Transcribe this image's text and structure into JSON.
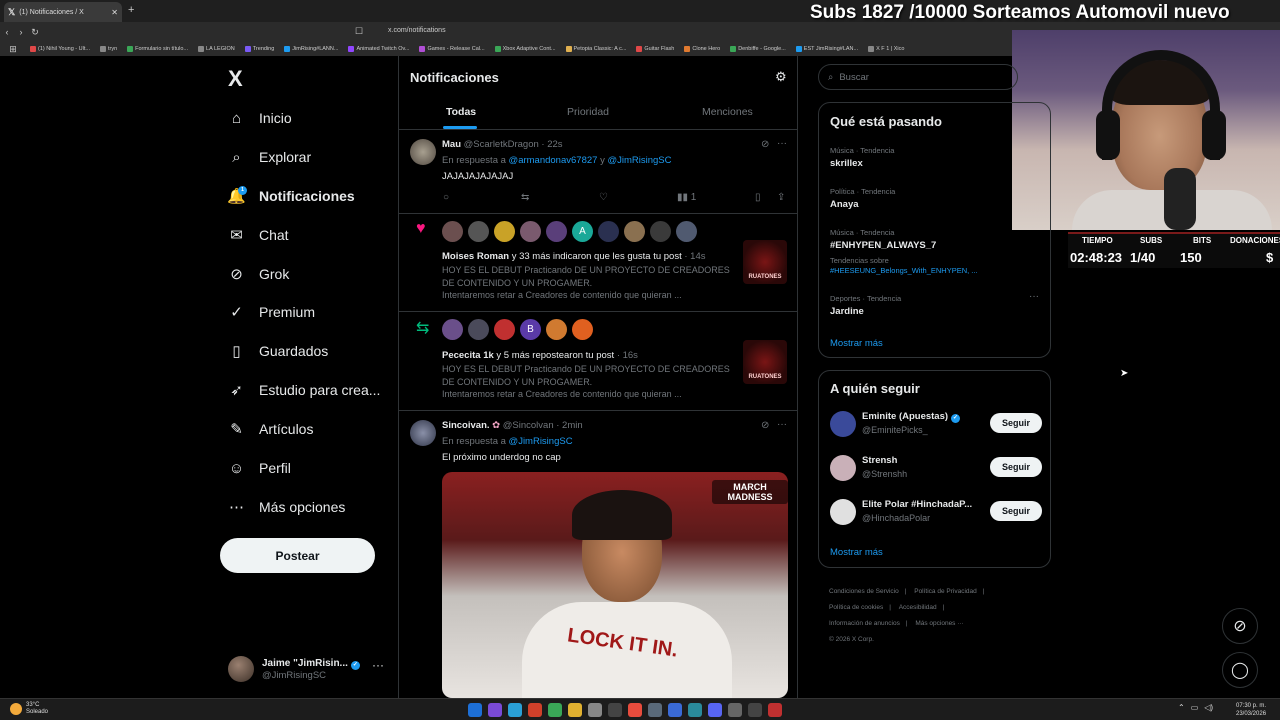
{
  "browser": {
    "tab_title": "(1) Notificaciones / X",
    "new_tab": "+",
    "url": "x.com/notifications",
    "bookmarks": [
      {
        "label": "(1) Nihil Young - Ult...",
        "color": "#e04848"
      },
      {
        "label": "tryn",
        "color": "#888888"
      },
      {
        "label": "Formulario sin título...",
        "color": "#3aa757"
      },
      {
        "label": "LA LEGION",
        "color": "#888888"
      },
      {
        "label": "Trending",
        "color": "#7a5af5"
      },
      {
        "label": "JimRising#LANN...",
        "color": "#1d9bf0"
      },
      {
        "label": "Animated Twitch Ov...",
        "color": "#9146ff"
      },
      {
        "label": "Games - Release Cal...",
        "color": "#b14fd6"
      },
      {
        "label": "Xbox Adaptive Cont...",
        "color": "#3aa757"
      },
      {
        "label": "Petopia Classic: A c...",
        "color": "#e0b050"
      },
      {
        "label": "Guitar Flash",
        "color": "#e04848"
      },
      {
        "label": "Clone Hero",
        "color": "#e07a30"
      },
      {
        "label": "Denbiffe - Google...",
        "color": "#3aa757"
      },
      {
        "label": "EST JimRising#LAN...",
        "color": "#1d9bf0"
      },
      {
        "label": "X F 1 | Xico",
        "color": "#888888"
      }
    ]
  },
  "overlay": {
    "banner": "Subs 1827 /10000 Sorteamos Automovil nuevo",
    "stats": {
      "headers": [
        "TIEMPO",
        "SUBS",
        "BITS",
        "DONACIONES"
      ],
      "values": [
        "02:48:23",
        "1/40",
        "150",
        "$"
      ]
    }
  },
  "sidebar": {
    "logo": "X",
    "items": [
      {
        "label": "Inicio",
        "icon": "home-icon",
        "glyph": "⌂"
      },
      {
        "label": "Explorar",
        "icon": "search-icon",
        "glyph": "⌕"
      },
      {
        "label": "Notificaciones",
        "icon": "bell-icon",
        "glyph": "🔔",
        "badge": "1"
      },
      {
        "label": "Chat",
        "icon": "mail-icon",
        "glyph": "✉"
      },
      {
        "label": "Grok",
        "icon": "grok-icon",
        "glyph": "⊘"
      },
      {
        "label": "Premium",
        "icon": "premium-icon",
        "glyph": "✓"
      },
      {
        "label": "Guardados",
        "icon": "bookmark-icon",
        "glyph": "▯"
      },
      {
        "label": "Estudio para crea...",
        "icon": "rocket-icon",
        "glyph": "➶"
      },
      {
        "label": "Artículos",
        "icon": "article-icon",
        "glyph": "✎"
      },
      {
        "label": "Perfil",
        "icon": "person-icon",
        "glyph": "☺"
      },
      {
        "label": "Más opciones",
        "icon": "more-icon",
        "glyph": "⋯"
      }
    ],
    "post_button": "Postear",
    "account": {
      "name": "Jaime \"JimRisin...",
      "handle": "@JimRisingSC",
      "more": "···"
    }
  },
  "main": {
    "title": "Notificaciones",
    "tabs": [
      "Todas",
      "Prioridad",
      "Menciones"
    ],
    "tweet1": {
      "name": "Mau",
      "handle": "@ScarletkDragon",
      "time": "· 22s",
      "reply_prefix": "En respuesta a",
      "reply_to1": "@armandonav67827",
      "reply_and": "y",
      "reply_to2": "@JimRisingSC",
      "text": "JAJAJAJAJAJAJ",
      "views": "1"
    },
    "like_notif": {
      "who": "Moises Roman",
      "action": "y 33 más indicaron que les gusta tu post",
      "time": "· 14s",
      "lines": [
        "HOY ES EL DEBUT Practicando DE UN PROYECTO DE CREADORES",
        "DE CONTENIDO Y UN PROGAMER.",
        "Intentaremos retar a Creadores de contenido que quieran ..."
      ],
      "logo_text": "RUATONES",
      "avatars": [
        {
          "color": "#6b4f4f",
          "letter": ""
        },
        {
          "color": "#555555",
          "letter": ""
        },
        {
          "color": "#c9a227",
          "letter": ""
        },
        {
          "color": "#7a5a6e",
          "letter": ""
        },
        {
          "color": "#5a3f7a",
          "letter": ""
        },
        {
          "color": "#1aa898",
          "letter": "A"
        },
        {
          "color": "#2a3050",
          "letter": ""
        },
        {
          "color": "#8a7050",
          "letter": ""
        },
        {
          "color": "#3a3a3a",
          "letter": ""
        },
        {
          "color": "#505a70",
          "letter": ""
        }
      ]
    },
    "rt_notif": {
      "who": "Pececita 1k",
      "action": "y 5 más repostearon tu post",
      "time": "· 16s",
      "lines": [
        "HOY ES EL DEBUT Practicando DE UN PROYECTO DE CREADORES",
        "DE CONTENIDO Y UN PROGAMER.",
        "Intentaremos retar a Creadores de contenido que quieran ..."
      ],
      "logo_text": "RUATONES",
      "avatars": [
        {
          "color": "#6a4f8a",
          "letter": ""
        },
        {
          "color": "#4a4a5a",
          "letter": ""
        },
        {
          "color": "#c03030",
          "letter": ""
        },
        {
          "color": "#5a3aa8",
          "letter": "B"
        },
        {
          "color": "#d07a30",
          "letter": ""
        },
        {
          "color": "#e06020",
          "letter": ""
        }
      ]
    },
    "tweet2": {
      "name": "Sincoivan.",
      "handle": "@Sincolvan",
      "time": "· 2min",
      "reply_prefix": "En respuesta a",
      "reply_to": "@JimRisingSC",
      "text": "El próximo underdog no cap",
      "media_brand": "MARCH MADNESS",
      "media_shirt_text": "LOCK IT IN."
    }
  },
  "right": {
    "search_placeholder": "Buscar",
    "trends_title": "Qué está pasando",
    "trends": [
      {
        "meta": "Música · Tendencia",
        "name": "skrillex"
      },
      {
        "meta": "Política · Tendencia",
        "name": "Anaya"
      },
      {
        "meta": "Música · Tendencia",
        "name": "#ENHYPEN_ALWAYS_7",
        "sub": "Tendencias sobre",
        "link": "#HEESEUNG_Belongs_With_ENHYPEN, ..."
      },
      {
        "meta": "Deportes · Tendencia",
        "name": "Jardine"
      }
    ],
    "trends_more": "Mostrar más",
    "follow_title": "A quién seguir",
    "follow": [
      {
        "name": "Eminite (Apuestas)",
        "handle": "@EminitePicks_",
        "verified": true,
        "color": "#3a4a9a"
      },
      {
        "name": "Strensh",
        "handle": "@Strenshh",
        "verified": false,
        "color": "#c9b0b8"
      },
      {
        "name": "Elite Polar #HinchadaP...",
        "handle": "@HinchadaPolar",
        "verified": false,
        "color": "#e0e0e0"
      }
    ],
    "follow_button": "Seguir",
    "follow_more": "Mostrar más",
    "footer": [
      "Condiciones de Servicio",
      "Política de Privacidad",
      "Política de cookies",
      "Accesibilidad",
      "Información de anuncios",
      "Más opciones ···",
      "© 2026 X Corp."
    ]
  },
  "taskbar": {
    "temp": "33°C",
    "condition": "Soleado",
    "time": "07:30 p. m.",
    "date": "23/03/2026"
  }
}
